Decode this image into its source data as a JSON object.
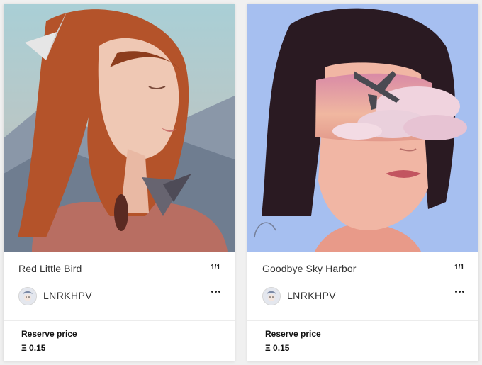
{
  "cards": [
    {
      "title": "Red Little Bird",
      "edition": "1/1",
      "artist": "LNRKHPV",
      "more_icon": "ellipsis-icon",
      "reserve_label": "Reserve price",
      "reserve_value": "Ξ 0.15",
      "colors": {
        "sky": "#9fc4cf",
        "hair": "#b4532a",
        "shirt": "#b86e62"
      }
    },
    {
      "title": "Goodbye Sky Harbor",
      "edition": "1/1",
      "artist": "LNRKHPV",
      "more_icon": "ellipsis-icon",
      "reserve_label": "Reserve price",
      "reserve_value": "Ξ 0.15",
      "colors": {
        "sky": "#a6bff0",
        "hair": "#2a1a22",
        "clouds": "#e6c0cf"
      }
    }
  ]
}
